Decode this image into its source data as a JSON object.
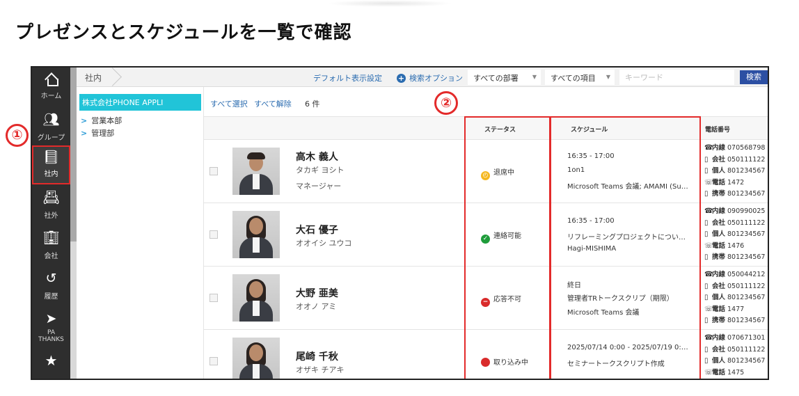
{
  "heading": "プレゼンスとスケジュールを一覧で確認",
  "colors": {
    "accent_red": "#e32a2a",
    "tree_active": "#21c4d8",
    "link": "#2b6cb0",
    "nav_bg": "#2e2e2e",
    "search_button": "#2c4fa3"
  },
  "nav": {
    "items": [
      {
        "label": "ホーム",
        "icon": "home-icon"
      },
      {
        "label": "グループ",
        "icon": "group-icon"
      },
      {
        "label": "社内",
        "icon": "contact-book-icon",
        "active": true
      },
      {
        "label": "社外",
        "icon": "id-card-icon"
      },
      {
        "label": "会社",
        "icon": "building-icon"
      },
      {
        "label": "履歴",
        "icon": "history-icon"
      },
      {
        "label": "PA THANKS",
        "icon": "paper-plane-icon"
      }
    ]
  },
  "callouts": {
    "one": "①",
    "two": "②"
  },
  "topbar": {
    "breadcrumb": "社内",
    "default_view": "デフォルト表示設定",
    "search_options": "検索オプション",
    "dept_select": "すべての部署",
    "item_select": "すべての項目",
    "keyword_placeholder": "キーワード",
    "search_button": "検索"
  },
  "tree": {
    "root": "株式会社PHONE APPLI",
    "children": [
      "営業本部",
      "管理部"
    ]
  },
  "list": {
    "select_all": "すべて選択",
    "deselect_all": "すべて解除",
    "count": "6 件"
  },
  "columns": {
    "status": "ステータス",
    "schedule": "スケジュール",
    "phone": "電話番号"
  },
  "rows": [
    {
      "name": "高木 義人",
      "kana": "タカギ ヨシト",
      "title": "マネージャー",
      "status": "退席中",
      "status_color": "#f5b821",
      "schedule": [
        "16:35 - 17:00",
        "1on1",
        "Microsoft Teams 会議; AMAMI (Su…"
      ],
      "phones": [
        {
          "kind": "内線",
          "number": "070568798"
        },
        {
          "kind": "会社",
          "number": "050111122"
        },
        {
          "kind": "個人",
          "number": "801234567"
        },
        {
          "kind": "電話",
          "number": "1472"
        },
        {
          "kind": "携帯",
          "number": "801234567"
        }
      ]
    },
    {
      "name": "大石 優子",
      "kana": "オオイシ ユウコ",
      "title": "",
      "status": "連絡可能",
      "status_color": "#1e9c3a",
      "schedule": [
        "16:35 - 17:00",
        "リフレーミングプロジェクトについ…",
        "Hagi-MISHIMA"
      ],
      "phones": [
        {
          "kind": "内線",
          "number": "090990025"
        },
        {
          "kind": "会社",
          "number": "050111122"
        },
        {
          "kind": "個人",
          "number": "801234567"
        },
        {
          "kind": "電話",
          "number": "1476"
        },
        {
          "kind": "携帯",
          "number": "801234567"
        }
      ]
    },
    {
      "name": "大野 亜美",
      "kana": "オオノ アミ",
      "title": "",
      "status": "応答不可",
      "status_color": "#d92b2b",
      "schedule": [
        "終日",
        "管理者TRトークスクリプ（期限）",
        "Microsoft Teams 会議"
      ],
      "phones": [
        {
          "kind": "内線",
          "number": "050044212"
        },
        {
          "kind": "会社",
          "number": "050111122"
        },
        {
          "kind": "個人",
          "number": "801234567"
        },
        {
          "kind": "電話",
          "number": "1477"
        },
        {
          "kind": "携帯",
          "number": "801234567"
        }
      ]
    },
    {
      "name": "尾崎 千秋",
      "kana": "オザキ チアキ",
      "title": "",
      "status": "取り込み中",
      "status_color": "#d92b2b",
      "schedule": [
        "2025/07/14 0:00 - 2025/07/19 0:…",
        "セミナートークスクリプト作成",
        ""
      ],
      "phones": [
        {
          "kind": "内線",
          "number": "070671301"
        },
        {
          "kind": "会社",
          "number": "050111122"
        },
        {
          "kind": "個人",
          "number": "801234567"
        },
        {
          "kind": "電話",
          "number": "1475"
        }
      ]
    }
  ]
}
